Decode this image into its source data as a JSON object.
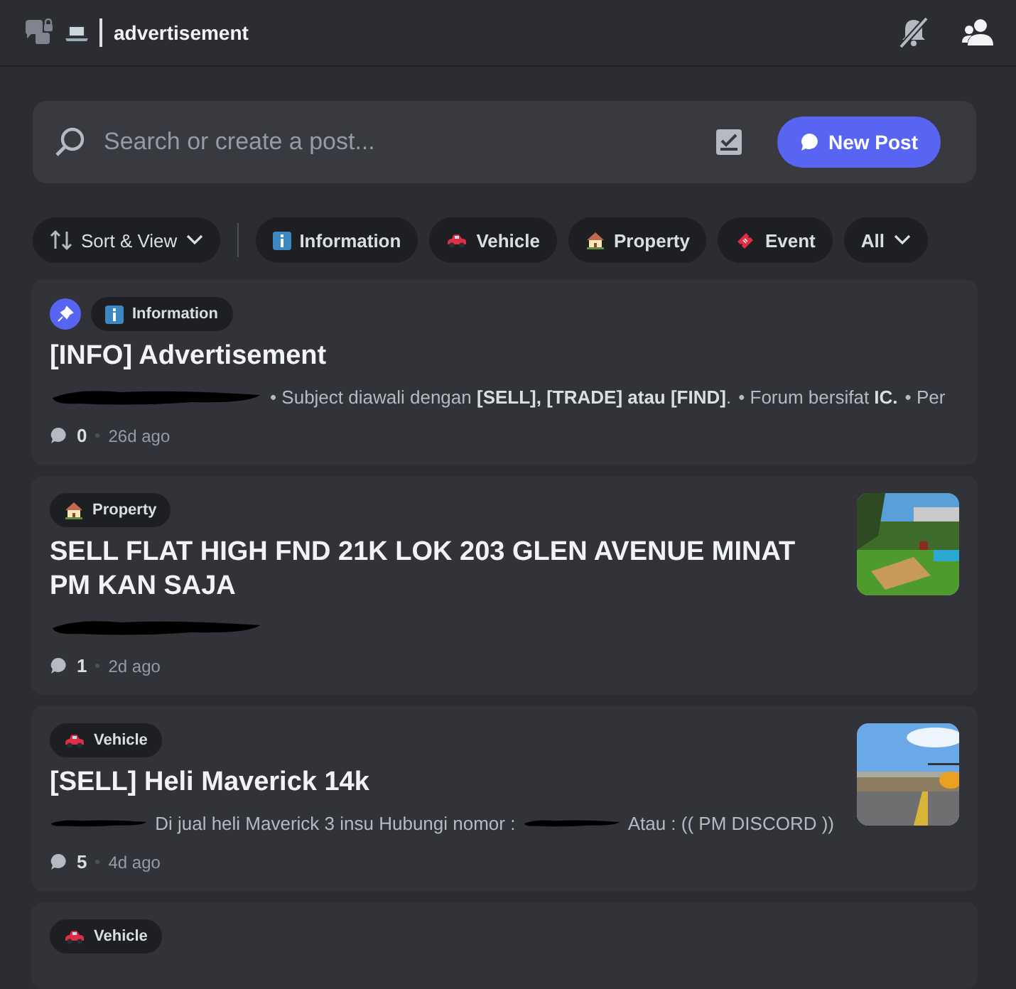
{
  "channel": {
    "name": "advertisement"
  },
  "search": {
    "placeholder": "Search or create a post..."
  },
  "new_post_button": {
    "label": "New Post"
  },
  "sort_button": {
    "label": "Sort & View"
  },
  "tags": [
    {
      "label": "Information",
      "kind": "info"
    },
    {
      "label": "Vehicle",
      "kind": "car"
    },
    {
      "label": "Property",
      "kind": "house"
    },
    {
      "label": "Event",
      "kind": "ticket"
    }
  ],
  "all_button": {
    "label": "All"
  },
  "posts": [
    {
      "pinned": true,
      "tag": {
        "label": "Information",
        "kind": "info"
      },
      "title": "[INFO] Advertisement",
      "preview": [
        {
          "kind": "redacted"
        },
        {
          "kind": "text",
          "text": "• Subject diawali dengan **[SELL], [TRADE] atau [FIND]**."
        },
        {
          "kind": "text",
          "text": "• Forum bersifat **IC.**"
        },
        {
          "kind": "text",
          "text": "• Per"
        }
      ],
      "replies": "0",
      "age": "26d ago"
    },
    {
      "pinned": false,
      "tag": {
        "label": "Property",
        "kind": "house"
      },
      "title": "SELL FLAT HIGH FND 21K LOK 203 GLEN AVENUE MINAT PM KAN SAJA",
      "preview": [
        {
          "kind": "redacted"
        }
      ],
      "replies": "1",
      "age": "2d ago"
    },
    {
      "pinned": false,
      "tag": {
        "label": "Vehicle",
        "kind": "car"
      },
      "title": "[SELL] Heli Maverick 14k",
      "preview": [
        {
          "kind": "redacted"
        },
        {
          "kind": "text",
          "text": "Di jual heli Maverick 3 insu Hubungi nomor :"
        },
        {
          "kind": "redacted"
        },
        {
          "kind": "text",
          "text": "Atau : (( PM DISCORD ))"
        }
      ],
      "replies": "5",
      "age": "4d ago"
    },
    {
      "pinned": false,
      "tag": {
        "label": "Vehicle",
        "kind": "car"
      }
    }
  ]
}
